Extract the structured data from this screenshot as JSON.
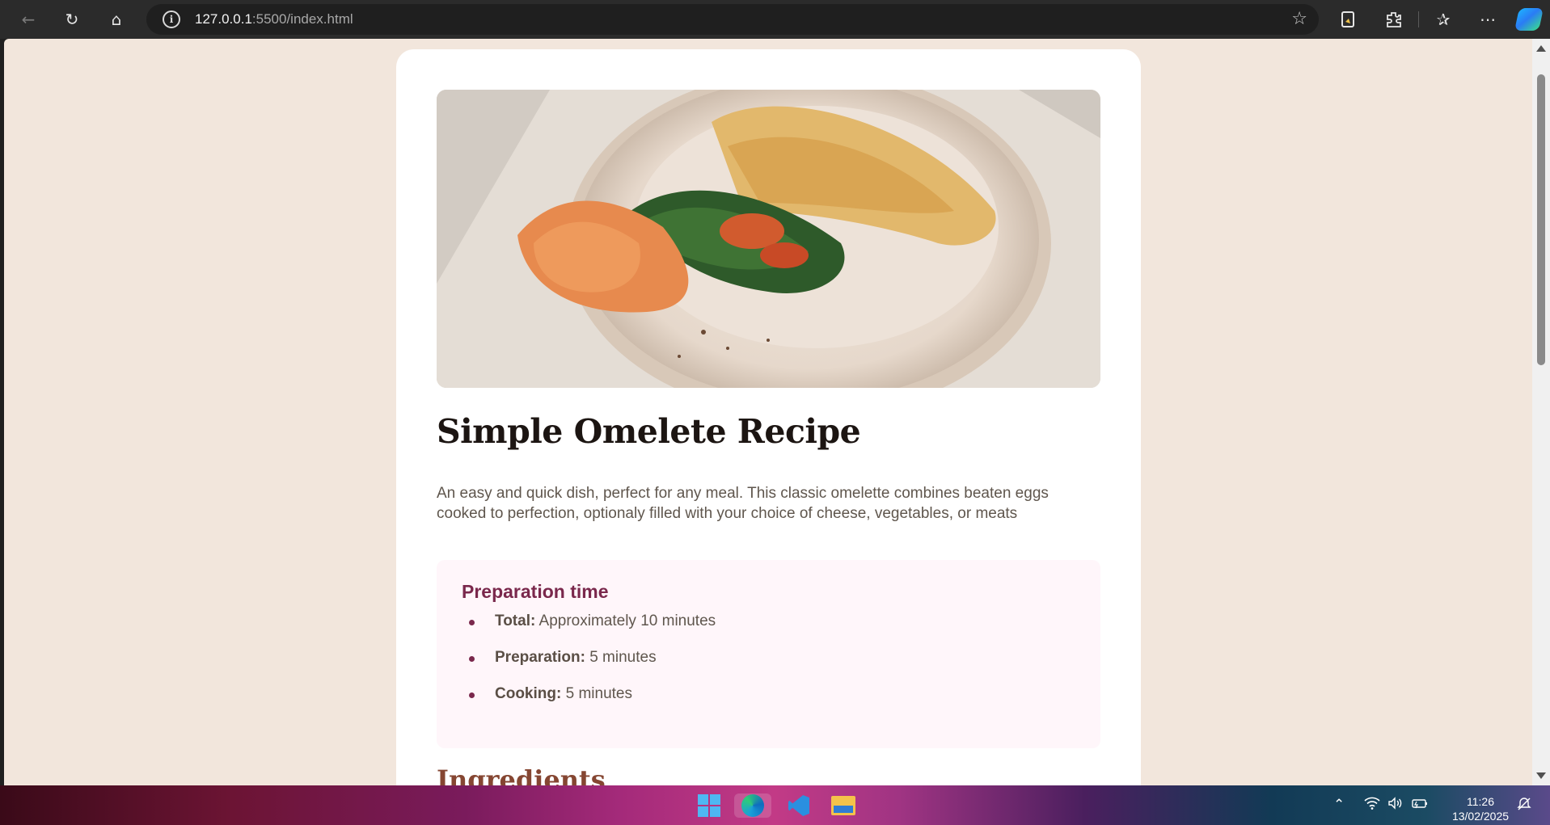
{
  "browser": {
    "url_host": "127.0.0.1",
    "url_path": ":5500/index.html",
    "icons": {
      "back": "back-arrow-icon",
      "reload": "reload-icon",
      "home": "home-icon",
      "info": "site-info-icon",
      "favorite": "star-icon",
      "extensions": "extensions-icon",
      "favorites": "favorites-icon",
      "more": "more-icon",
      "copilot": "copilot-icon"
    }
  },
  "page": {
    "title": "Simple Omelete Recipe",
    "description": "An easy and quick dish, perfect for any meal. This classic omelette combines beaten eggs cooked to perfection, optionaly filled with your choice of cheese, vegetables, or meats",
    "preparation": {
      "title": "Preparation time",
      "items": [
        {
          "label": "Total:",
          "value": "Approximately 10 minutes"
        },
        {
          "label": "Preparation:",
          "value": "5 minutes"
        },
        {
          "label": "Cooking:",
          "value": "5 minutes"
        }
      ]
    },
    "ingredients_title": "Ingredients",
    "colors": {
      "background": "#f2e6dc",
      "card": "#ffffff",
      "prep_background": "#fff6fa",
      "prep_accent": "#7a284c",
      "heading_brown": "#854632",
      "body_text": "#5f564d"
    }
  },
  "taskbar": {
    "time": "11:26",
    "date": "13/02/2025",
    "apps": [
      "windows-start-icon",
      "edge-icon",
      "vscode-icon",
      "file-explorer-icon"
    ]
  }
}
